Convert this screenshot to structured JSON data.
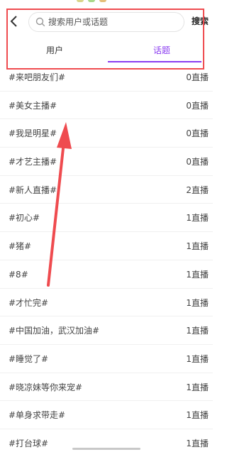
{
  "header": {
    "search_placeholder": "搜索用户或话题",
    "search_button": "搜索"
  },
  "tabs": [
    {
      "label": "用户",
      "active": false
    },
    {
      "label": "话题",
      "active": true
    }
  ],
  "accent_color": "#8a3cf0",
  "annotation_color": "#ef4b4f",
  "topics": [
    {
      "name": "#来吧朋友们#",
      "count": "0直播"
    },
    {
      "name": "#美女主播#",
      "count": "0直播"
    },
    {
      "name": "#我是明星#",
      "count": "0直播"
    },
    {
      "name": "#才艺主播#",
      "count": "0直播"
    },
    {
      "name": "#新人直播#",
      "count": "2直播"
    },
    {
      "name": "#初心#",
      "count": "1直播"
    },
    {
      "name": "#猪#",
      "count": "1直播"
    },
    {
      "name": "#8#",
      "count": "1直播"
    },
    {
      "name": "#才忙完#",
      "count": "1直播"
    },
    {
      "name": "#中国加油，武汉加油#",
      "count": "1直播"
    },
    {
      "name": "#睡觉了#",
      "count": "1直播"
    },
    {
      "name": "#晓凉妹等你来宠#",
      "count": "1直播"
    },
    {
      "name": "#单身求带走#",
      "count": "1直播"
    },
    {
      "name": "#打台球#",
      "count": "1直播"
    }
  ]
}
